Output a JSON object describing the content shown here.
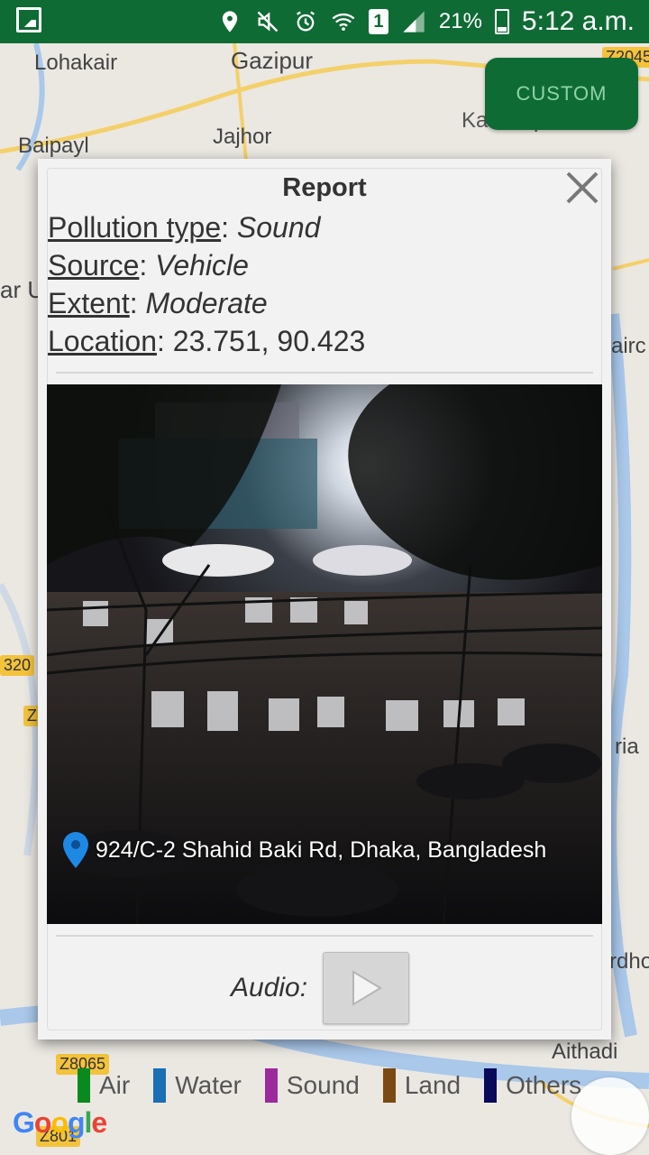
{
  "status_bar": {
    "battery_percent": "21%",
    "time": "5:12 a.m.",
    "sim_slot": "1"
  },
  "map": {
    "labels": [
      "Lohakair",
      "Gazipur",
      "Baipayl",
      "Jajhor",
      "Kashimpur",
      "ar U",
      "airc",
      "ria",
      "rdho",
      "Aithadi"
    ],
    "road_badges": [
      "Z2045",
      "320",
      "Z",
      "Z8065",
      "Z801"
    ],
    "custom_button": "CUSTOM"
  },
  "report": {
    "title": "Report",
    "fields": [
      {
        "key": "Pollution type",
        "value": "Sound",
        "italic": true
      },
      {
        "key": "Source",
        "value": "Vehicle",
        "italic": true
      },
      {
        "key": "Extent",
        "value": "Moderate",
        "italic": true
      },
      {
        "key": "Location",
        "value": "23.751, 90.423",
        "italic": false
      }
    ],
    "address": "924/C-2 Shahid Baki Rd, Dhaka, Bangladesh",
    "audio_label": "Audio:"
  },
  "legend": [
    {
      "label": "Air",
      "color": "#0a8a1e"
    },
    {
      "label": "Water",
      "color": "#1a6fb5"
    },
    {
      "label": "Sound",
      "color": "#9c2a9e"
    },
    {
      "label": "Land",
      "color": "#7a4a12"
    },
    {
      "label": "Others",
      "color": "#0a0a5a"
    }
  ],
  "branding": {
    "google": "Google"
  }
}
